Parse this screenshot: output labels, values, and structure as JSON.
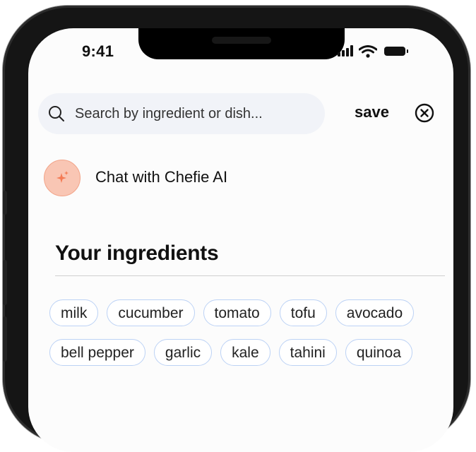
{
  "status_bar": {
    "time": "9:41"
  },
  "search": {
    "placeholder": "Search by ingredient or dish..."
  },
  "actions": {
    "save_label": "save"
  },
  "chat": {
    "label": "Chat with Chefie AI"
  },
  "ingredients": {
    "title": "Your ingredients",
    "rows": [
      [
        "milk",
        "cucumber",
        "tomato",
        "tofu",
        "avocado"
      ],
      [
        "bell pepper",
        "garlic",
        "kale",
        "tahini",
        "quinoa"
      ]
    ]
  },
  "colors": {
    "accent": "#f47b54",
    "chip_border": "#bcd2f5",
    "search_bg": "#f1f3f8"
  },
  "icons": [
    "search-icon",
    "close-icon",
    "sparkle-icon",
    "signal-icon",
    "wifi-icon",
    "battery-icon"
  ]
}
